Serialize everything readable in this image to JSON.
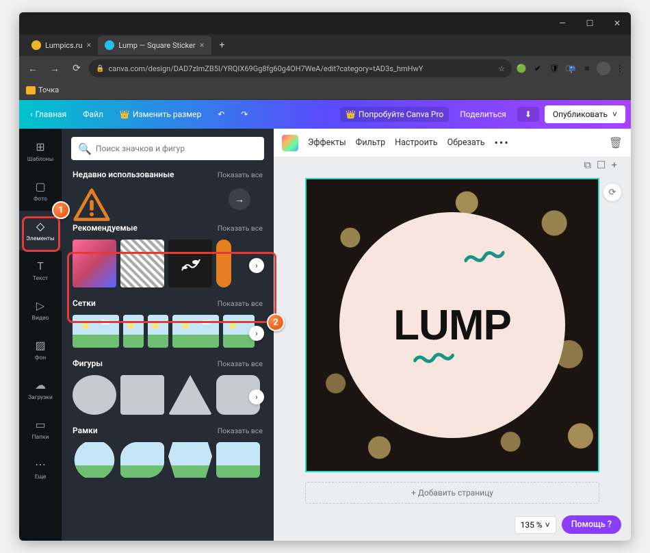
{
  "tabs": [
    {
      "label": "Lumpics.ru",
      "favicon": "#f0b429"
    },
    {
      "label": "Lump — Square Sticker",
      "favicon": "#22c3e6",
      "active": true
    }
  ],
  "url": "canva.com/design/DAD7zlmZB5I/YRQIX69Gg8fg60g4OH7WeA/edit?category=tAD3s_hmHwY",
  "bookmarks": [
    {
      "label": "Точка"
    }
  ],
  "canva_header": {
    "home": "Главная",
    "file": "Файл",
    "resize": "Изменить размер",
    "pro": "Попробуйте Canva Pro",
    "share": "Поделиться",
    "publish": "Опубликовать"
  },
  "sidenav": [
    {
      "id": "templates",
      "label": "Шаблоны",
      "icon": "⊞"
    },
    {
      "id": "photo",
      "label": "Фото",
      "icon": "▢"
    },
    {
      "id": "elements",
      "label": "Элементы",
      "icon": "◇",
      "active": true
    },
    {
      "id": "text",
      "label": "Текст",
      "icon": "T"
    },
    {
      "id": "video",
      "label": "Видео",
      "icon": "▷"
    },
    {
      "id": "background",
      "label": "Фон",
      "icon": "▨"
    },
    {
      "id": "uploads",
      "label": "Загрузки",
      "icon": "☁"
    },
    {
      "id": "folders",
      "label": "Папки",
      "icon": "▭"
    },
    {
      "id": "more",
      "label": "Еще",
      "icon": "⋯"
    }
  ],
  "search": {
    "placeholder": "Поиск значков и фигур"
  },
  "sections": {
    "recent": {
      "title": "Недавно использованные",
      "all": "Показать все"
    },
    "recommended": {
      "title": "Рекомендуемые",
      "all": "Показать все"
    },
    "grids": {
      "title": "Сетки",
      "all": "Показать все"
    },
    "shapes": {
      "title": "Фигуры",
      "all": "Показать все"
    },
    "frames": {
      "title": "Рамки",
      "all": "Показать все"
    }
  },
  "ctx": {
    "effects": "Эффекты",
    "filter": "Фильтр",
    "adjust": "Настроить",
    "crop": "Обрезать",
    "more": "•••"
  },
  "sticker_text": "LUMP",
  "add_page": "+ Добавить страницу",
  "zoom": "135 %",
  "help": "Помощь ?",
  "markers": {
    "one": "1",
    "two": "2"
  }
}
